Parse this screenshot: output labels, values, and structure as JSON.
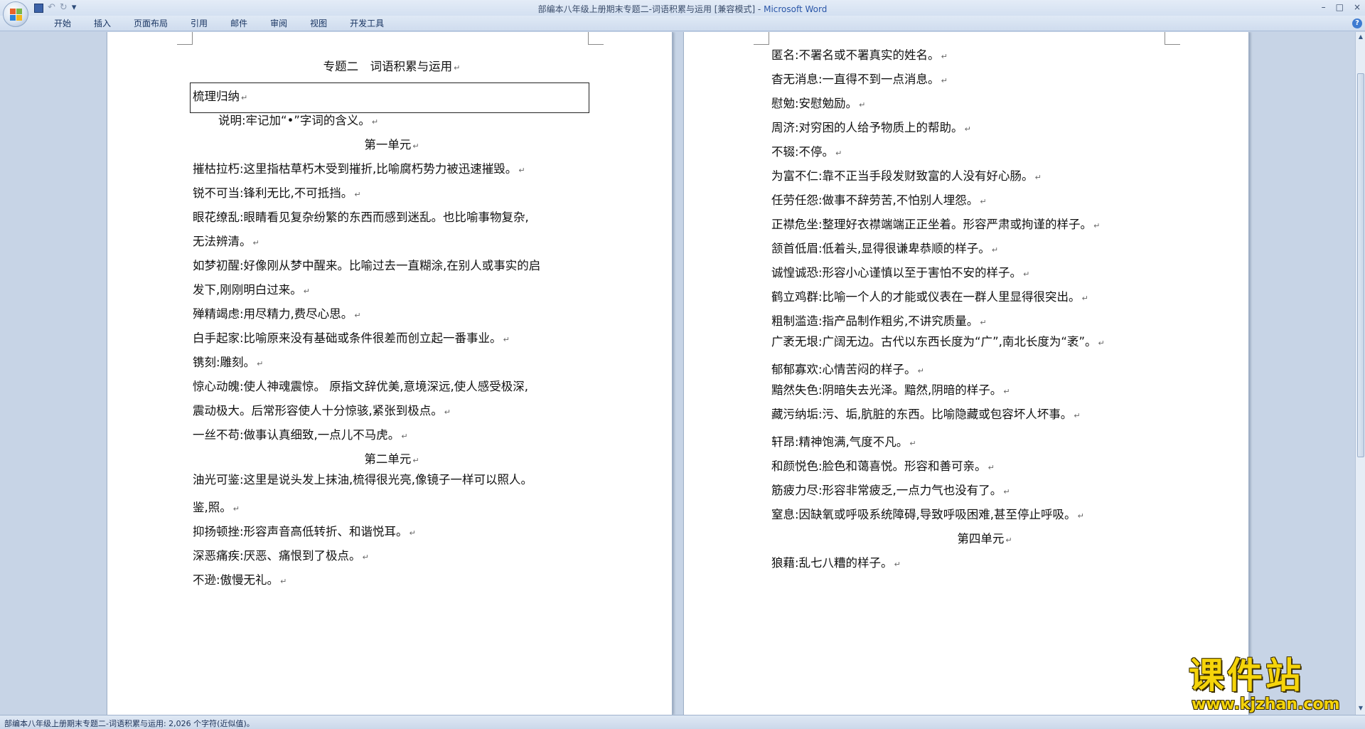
{
  "window": {
    "title": "部编本八年级上册期末专题二-词语积累与运用 [兼容模式] - ",
    "app": "Microsoft Word",
    "controls": [
      "–",
      "□",
      "×"
    ]
  },
  "qat": {
    "undo": "↶",
    "redo": "↻",
    "more": "▾"
  },
  "ribbon": {
    "tabs": [
      "开始",
      "插入",
      "页面布局",
      "引用",
      "邮件",
      "审阅",
      "视图",
      "开发工具"
    ],
    "help": "?"
  },
  "left_page": {
    "title": "专题二　词语积累与运用",
    "box_heading": "梳理归纳",
    "note": "说明:牢记加“•”字词的含义。",
    "unit1": "第一单元",
    "unit2": "第二单元",
    "entries": [
      "摧枯拉朽:这里指枯草朽木受到摧折,比喻腐朽势力被迅速摧毁。",
      "锐不可当:锋利无比,不可抵挡。",
      "眼花缭乱:眼睛看见复杂纷繁的东西而感到迷乱。也比喻事物复杂,",
      "无法辨清。",
      "如梦初醒:好像刚从梦中醒来。比喻过去一直糊涂,在别人或事实的启",
      "发下,刚刚明白过来。",
      "殚精竭虑:用尽精力,费尽心思。",
      "白手起家:比喻原来没有基础或条件很差而创立起一番事业。",
      "镌刻:雕刻。",
      "惊心动魄:使人神魂震惊。 原指文辞优美,意境深远,使人感受极深,",
      "震动极大。后常形容使人十分惊骇,紧张到极点。",
      "一丝不苟:做事认真细致,一点儿不马虎。"
    ],
    "entries2": [
      "油光可鉴:这里是说头发上抹油,梳得很光亮,像镜子一样可以照人。",
      "鉴,照。",
      "抑扬顿挫:形容声音高低转折、和谐悦耳。",
      "深恶痛疾:厌恶、痛恨到了极点。",
      "不逊:傲慢无礼。"
    ]
  },
  "right_page": {
    "entries": [
      "匿名:不署名或不署真实的姓名。",
      "杳无消息:一直得不到一点消息。",
      "慰勉:安慰勉励。",
      "周济:对穷困的人给予物质上的帮助。",
      "不辍:不停。",
      "为富不仁:靠不正当手段发财致富的人没有好心肠。",
      "任劳任怨:做事不辞劳苦,不怕别人埋怨。",
      "正襟危坐:整理好衣襟端端正正坐着。形容严肃或拘谨的样子。",
      "颔首低眉:低着头,显得很谦卑恭顺的样子。",
      "诚惶诚恐:形容小心谨慎以至于害怕不安的样子。",
      "鹤立鸡群:比喻一个人的才能或仪表在一群人里显得很突出。",
      "粗制滥造:指产品制作粗劣,不讲究质量。",
      "广袤无垠:广阔无边。古代以东西长度为“广”,南北长度为“袤”。",
      "郁郁寡欢:心情苦闷的样子。",
      "黯然失色:阴暗失去光泽。黯然,阴暗的样子。",
      "藏污纳垢:污、垢,肮脏的东西。比喻隐藏或包容坏人坏事。",
      "轩昂:精神饱满,气度不凡。",
      "和颜悦色:脸色和蔼喜悦。形容和善可亲。",
      "筋疲力尽:形容非常疲乏,一点力气也没有了。",
      "窒息:因缺氧或呼吸系统障碍,导致呼吸困难,甚至停止呼吸。"
    ],
    "unit4": "第四单元",
    "last": "狼藉:乱七八糟的样子。"
  },
  "statusbar": {
    "text": "部编本八年级上册期末专题二-词语积累与运用: 2,026 个字符(近似值)。"
  },
  "watermark": {
    "name": "课件站",
    "url": "www.kjzhan.com"
  },
  "pilcrow": "↵",
  "icons": [
    "office-button-icon",
    "save-icon",
    "undo-icon",
    "redo-icon",
    "help-icon",
    "scroll-up-icon",
    "scroll-down-icon"
  ]
}
